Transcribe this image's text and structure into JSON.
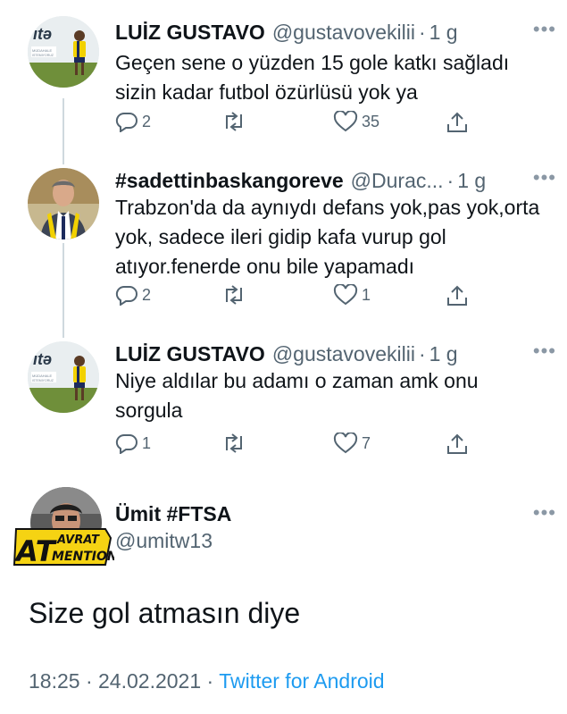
{
  "tweets": [
    {
      "name": "LUİZ GUSTAVO",
      "handle": "@gustavovekilii",
      "sep": "·",
      "time": "1 g",
      "text": "Geçen sene o yüzden 15 gole katkı sağladı sizin kadar futbol özürlüsü yok ya",
      "replies": "2",
      "retweets": "",
      "likes": "35"
    },
    {
      "name": "#sadettinbaskangoreve",
      "handle": "@Durac...",
      "sep": "·",
      "time": "1 g",
      "text": "Trabzon'da da aynıydı defans yok,pas yok,orta yok, sadece ileri gidip kafa vurup gol atıyor.fenerde onu bile yapamadı",
      "replies": "2",
      "retweets": "",
      "likes": "1"
    },
    {
      "name": "LUİZ GUSTAVO",
      "handle": "@gustavovekilii",
      "sep": "·",
      "time": "1 g",
      "text": "Niye aldılar bu adamı o zaman amk onu sorgula",
      "replies": "1",
      "retweets": "",
      "likes": "7"
    }
  ],
  "main_tweet": {
    "name": "Ümit #FTSA",
    "handle": "@umitw13",
    "badge_top": "AT",
    "badge_word1": "AVRAT",
    "badge_word2": "MENTION",
    "text": "Size gol atmasın diye",
    "time": "18:25",
    "sep": "·",
    "date": "24.02.2021",
    "sep2": "·",
    "source": "Twitter for Android"
  },
  "more_glyph": "•••",
  "avatar_caption": "MÜDAHALE ISTEMIYORUZ",
  "icons": [
    "reply-icon",
    "retweet-icon",
    "like-icon",
    "share-icon",
    "more-icon"
  ],
  "colors": {
    "text": "#0f1419",
    "secondary": "#536471",
    "link": "#1d9bf0",
    "line": "#cfd9de"
  }
}
